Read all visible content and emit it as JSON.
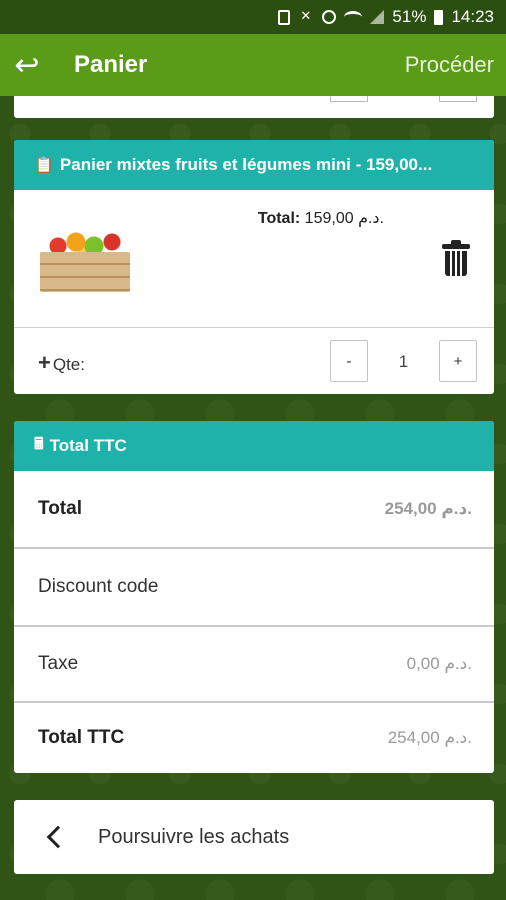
{
  "status_bar": {
    "battery_percent": "51%",
    "time": "14:23"
  },
  "app_bar": {
    "title": "Panier",
    "proceed_label": "Procéder"
  },
  "product_card": {
    "title": "Panier mixtes fruits et légumes mini - 159,00...",
    "total_label": "Total:",
    "total_value": "159,00 د.م.",
    "qty_label": "Qte:",
    "qty_minus": "-",
    "qty_plus": "+",
    "qty_value": "1"
  },
  "summary_card": {
    "title": "Total TTC",
    "rows": [
      {
        "name": "Total",
        "value": "254,00 د.م."
      },
      {
        "name": "Discount code",
        "value": ""
      },
      {
        "name": "Taxe",
        "value": "0,00 د.م."
      },
      {
        "name": "Total TTC",
        "value": "254,00 د.م."
      }
    ]
  },
  "continue_shopping": {
    "label": "Poursuivre les achats"
  },
  "colors": {
    "app_bar": "#5a9b18",
    "card_header": "#1fb2aa",
    "background": "#2f5413"
  }
}
